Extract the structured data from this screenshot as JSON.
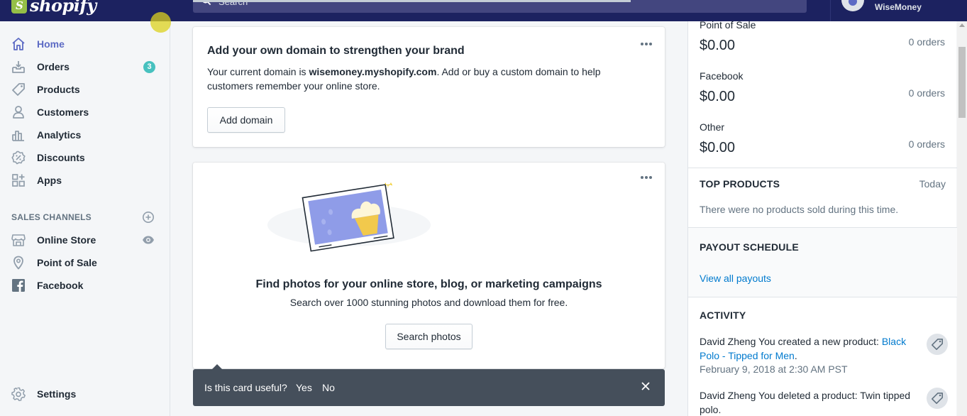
{
  "topbar": {
    "logo_text": "shopify",
    "search_placeholder": "Search",
    "store_name": "WiseMoney"
  },
  "sidebar": {
    "items": [
      {
        "label": "Home",
        "icon": "home-icon",
        "active": true
      },
      {
        "label": "Orders",
        "icon": "orders-icon",
        "badge": "3"
      },
      {
        "label": "Products",
        "icon": "tag-icon"
      },
      {
        "label": "Customers",
        "icon": "person-icon"
      },
      {
        "label": "Analytics",
        "icon": "bar-chart-icon"
      },
      {
        "label": "Discounts",
        "icon": "discount-icon"
      },
      {
        "label": "Apps",
        "icon": "apps-icon"
      }
    ],
    "sales_channels_title": "SALES CHANNELS",
    "channels": [
      {
        "label": "Online Store",
        "icon": "store-icon"
      },
      {
        "label": "Point of Sale",
        "icon": "location-pin-icon"
      },
      {
        "label": "Facebook",
        "icon": "facebook-icon"
      }
    ],
    "settings_label": "Settings"
  },
  "main": {
    "domain_card": {
      "title": "Add your own domain to strengthen your brand",
      "body_prefix": "Your current domain is ",
      "current_domain": "wisemoney.myshopify.com",
      "body_suffix": ". Add or buy a custom domain to help customers remember your online store.",
      "button_label": "Add domain"
    },
    "photos_card": {
      "title": "Find photos for your online store, blog, or marketing campaigns",
      "subtitle": "Search over 1000 stunning photos and download them for free.",
      "button_label": "Search photos"
    },
    "feedback_toast": {
      "question": "Is this card useful?",
      "yes_label": "Yes",
      "no_label": "No"
    }
  },
  "right_column": {
    "sales_by_channel": [
      {
        "channel": "Point of Sale",
        "amount": "$0.00",
        "orders": "0 orders"
      },
      {
        "channel": "Facebook",
        "amount": "$0.00",
        "orders": "0 orders"
      },
      {
        "channel": "Other",
        "amount": "$0.00",
        "orders": "0 orders"
      }
    ],
    "top_products": {
      "title": "TOP PRODUCTS",
      "period": "Today",
      "empty_text": "There were no products sold during this time."
    },
    "payout_schedule": {
      "title": "PAYOUT SCHEDULE",
      "link_label": "View all payouts"
    },
    "activity": {
      "title": "ACTIVITY",
      "items": [
        {
          "text_prefix": "David Zheng You created a new product: ",
          "link_text": "Black Polo - Tipped for Men",
          "text_suffix": ".",
          "time": "February 9, 2018 at 2:30 AM PST"
        },
        {
          "text_prefix": "David Zheng You deleted a product: Twin tipped polo.",
          "link_text": "",
          "text_suffix": "",
          "time": ""
        }
      ]
    }
  },
  "colors": {
    "topbar": "#1c2260",
    "accent": "#5c6ac4",
    "badge": "#47c1bf",
    "link": "#007ace",
    "toast": "#454f5b"
  }
}
